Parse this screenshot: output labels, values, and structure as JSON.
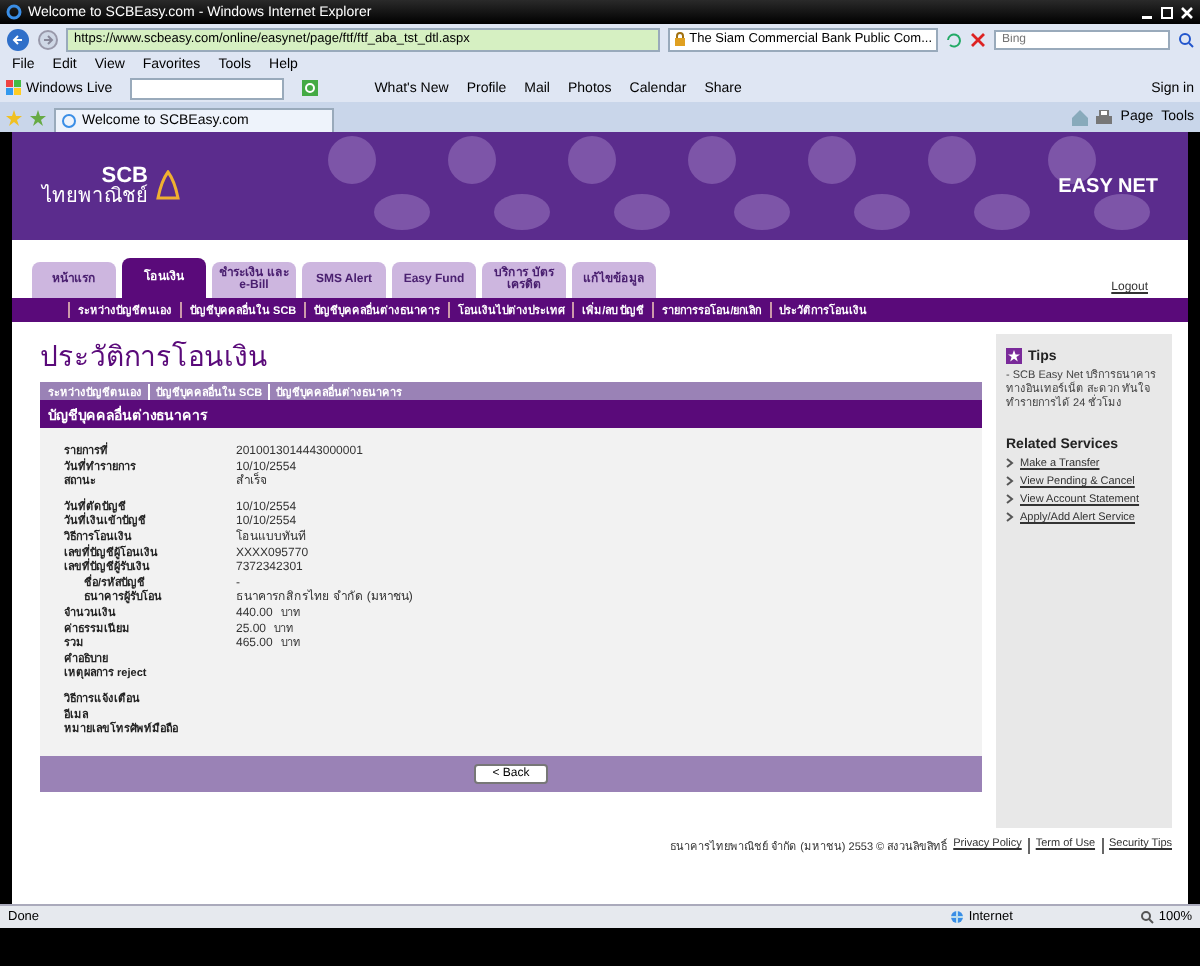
{
  "browser": {
    "title": "Welcome to SCBEasy.com - Windows Internet Explorer",
    "address": "https://www.scbeasy.com/online/easynet/page/ftf/ftf_aba_tst_dtl.aspx",
    "certificate": "The Siam Commercial Bank Public Com...",
    "search_placeholder": "Bing",
    "menu": [
      "File",
      "Edit",
      "View",
      "Favorites",
      "Tools",
      "Help"
    ],
    "live_label": "Windows Live",
    "live_items": [
      "What's New",
      "Profile",
      "Mail",
      "Photos",
      "Calendar",
      "Share"
    ],
    "sign_in": "Sign in",
    "tab": "Welcome to SCBEasy.com",
    "commands": [
      "Page",
      "Tools"
    ]
  },
  "header": {
    "logo_en": "SCB",
    "logo_th": "ไทยพาณิชย์",
    "product": "EASY NET"
  },
  "tabs": [
    {
      "label": "หน้าแรก",
      "selected": false
    },
    {
      "label": "โอนเงิน",
      "selected": true
    },
    {
      "label": "ชำระเงิน และ e-Bill",
      "selected": false
    },
    {
      "label": "SMS Alert",
      "selected": false
    },
    {
      "label": "Easy Fund",
      "selected": false
    },
    {
      "label": "บริการ บัตรเครดิต",
      "selected": false
    },
    {
      "label": "แก้ไขข้อมูล",
      "selected": false
    }
  ],
  "logout": "Logout",
  "subnav": [
    "ระหว่างบัญชีตนเอง",
    "บัญชีบุคคลอื่นใน SCB",
    "บัญชีบุคคลอื่นต่างธนาคาร",
    "โอนเงินไปต่างประเทศ",
    "เพิ่ม/ลบ บัญชี",
    "รายการรอโอน/ยกเลิก",
    "ประวัติการโอนเงิน"
  ],
  "page_title": "ประวัติการโอนเงิน",
  "breadcrumb": [
    "ระหว่างบัญชีตนเอง",
    "บัญชีบุคคลอื่นใน SCB",
    "บัญชีบุคคลอื่นต่างธนาคาร"
  ],
  "section_title": "บัญชีบุคคลอื่นต่างธนาคาร",
  "detail_groups": [
    [
      {
        "label": "รายการที่",
        "value": "2010013014443000001"
      },
      {
        "label": "วันที่ทำรายการ",
        "value": "10/10/2554"
      },
      {
        "label": "สถานะ",
        "value": "สำเร็จ"
      }
    ],
    [
      {
        "label": "วันที่ตัดบัญชี",
        "value": "10/10/2554"
      },
      {
        "label": "วันที่เงินเข้าบัญชี",
        "value": "10/10/2554"
      },
      {
        "label": "วิธีการโอนเงิน",
        "value": "โอนแบบทันที"
      },
      {
        "label": "เลขที่บัญชีผู้โอนเงิน",
        "value": "XXXX095770"
      },
      {
        "label": "เลขที่บัญชีผู้รับเงิน",
        "value": "7372342301",
        "children": [
          {
            "label": "ชื่อ/รหัสบัญชี",
            "value": "-"
          },
          {
            "label": "ธนาคารผู้รับโอน",
            "value": "ธนาคารกสิกรไทย จำกัด (มหาชน)"
          }
        ]
      },
      {
        "label": "จำนวนเงิน",
        "value": "440.00",
        "unit": "บาท"
      },
      {
        "label": "ค่าธรรมเนียม",
        "value": "25.00",
        "unit": "บาท"
      },
      {
        "label": "รวม",
        "value": "465.00",
        "unit": "บาท"
      },
      {
        "label": "คำอธิบาย"
      },
      {
        "label": "เหตุผลการ reject"
      }
    ],
    [
      {
        "label": "วิธีการแจ้งเตือน"
      },
      {
        "label": "อีเมล"
      },
      {
        "label": "หมายเลขโทรศัพท์มือถือ"
      }
    ]
  ],
  "back_button": "< Back",
  "sidebar": {
    "tips_title": "Tips",
    "tips_text": "- SCB Easy Net บริการธนาคารทางอินเทอร์เน็ต สะดวก ทันใจ ทำรายการได้ 24 ชั่วโมง",
    "related_title": "Related Services",
    "links": [
      "Make a Transfer",
      "View Pending & Cancel",
      "View Account Statement",
      "Apply/Add Alert Service"
    ]
  },
  "footer": {
    "copyright": "ธนาคารไทยพาณิชย์ จำกัด (มหาชน) 2553 © สงวนลิขสิทธิ์",
    "links": [
      "Privacy Policy",
      "Term of Use",
      "Security Tips"
    ]
  },
  "status": {
    "text": "Done",
    "zone": "Internet",
    "zoom": "100%"
  }
}
